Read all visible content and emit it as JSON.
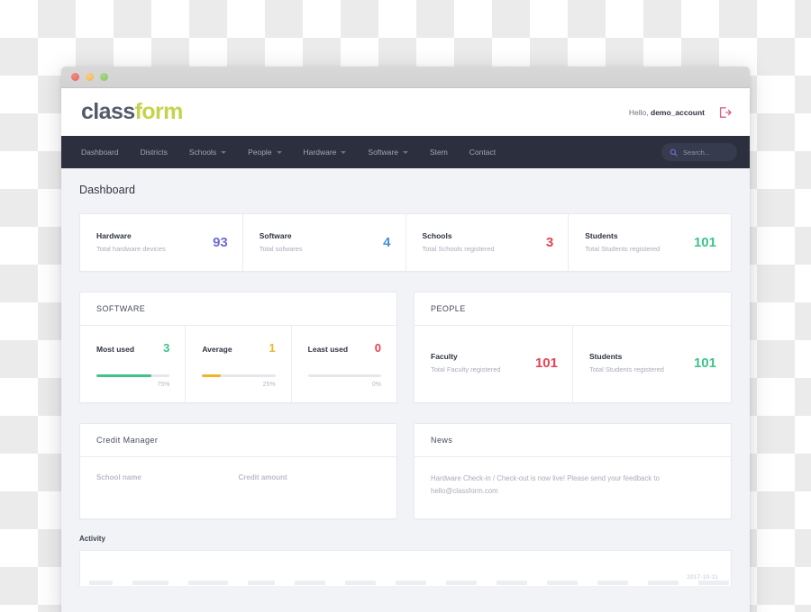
{
  "window": {
    "traffic_lights": [
      "close",
      "minimize",
      "maximize"
    ]
  },
  "header": {
    "logo_part_a": "class",
    "logo_part_b": "form",
    "greeting_prefix": "Hello,",
    "account_name": "demo_account",
    "logout_icon": "logout-icon",
    "logo_color_a": "#545b6b",
    "logo_color_b": "#c4d44a",
    "logout_color": "#d95f8e"
  },
  "nav": {
    "items": [
      {
        "label": "Dashboard",
        "has_caret": false
      },
      {
        "label": "Districts",
        "has_caret": false
      },
      {
        "label": "Schools",
        "has_caret": true
      },
      {
        "label": "People",
        "has_caret": true
      },
      {
        "label": "Hardware",
        "has_caret": true
      },
      {
        "label": "Software",
        "has_caret": true
      },
      {
        "label": "Stem",
        "has_caret": false
      },
      {
        "label": "Contact",
        "has_caret": false
      }
    ],
    "search": {
      "icon": "search-icon",
      "placeholder": "Search...",
      "value": ""
    },
    "bg_color": "#2b2f3e"
  },
  "page": {
    "title": "Dashboard"
  },
  "kpis": [
    {
      "label": "Hardware",
      "sub": "Total hardware devices",
      "value": "93",
      "color": "#6c6cd8"
    },
    {
      "label": "Software",
      "sub": "Total sofwares",
      "value": "4",
      "color": "#4a90e2"
    },
    {
      "label": "Schools",
      "sub": "Total Schools registered",
      "value": "3",
      "color": "#e8414f"
    },
    {
      "label": "Students",
      "sub": "Total Students registered",
      "value": "101",
      "color": "#3cc48a"
    }
  ],
  "software_panel": {
    "title": "SOFTWARE",
    "cells": [
      {
        "label": "Most used",
        "value": "3",
        "color": "#3cc48a",
        "percent_label": "75%",
        "percent": 75,
        "bar_color": "#3cc48a"
      },
      {
        "label": "Average",
        "value": "1",
        "color": "#f0b429",
        "percent_label": "25%",
        "percent": 25,
        "bar_color": "#f0b429"
      },
      {
        "label": "Least used",
        "value": "0",
        "color": "#e8414f",
        "percent_label": "0%",
        "percent": 0,
        "bar_color": "#e6e7eb"
      }
    ]
  },
  "people_panel": {
    "title": "PEOPLE",
    "cells": [
      {
        "label": "Faculty",
        "sub": "Total Faculty registered",
        "value": "101",
        "color": "#e8414f"
      },
      {
        "label": "Students",
        "sub": "Total Students registered",
        "value": "101",
        "color": "#3cc48a"
      }
    ]
  },
  "credit_manager": {
    "title": "Credit Manager",
    "col_school": "School name",
    "col_amount": "Credit amount"
  },
  "news": {
    "title": "News",
    "body": "Hardware Check-in / Check-out is now live! Please send your feedback to hello@classform.com"
  },
  "activity": {
    "title": "Activity",
    "date": "2017-10-11"
  }
}
